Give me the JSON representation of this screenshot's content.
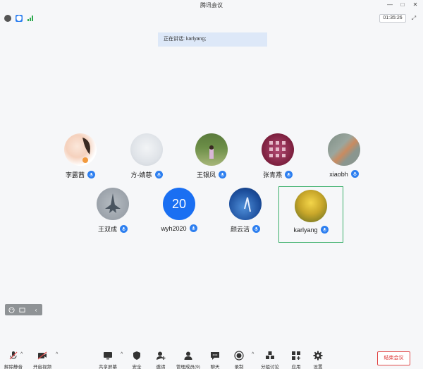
{
  "window": {
    "title": "腾讯会议",
    "minimize": "—",
    "maximize": "□",
    "close": "✕"
  },
  "status": {
    "timer": "01:35:26"
  },
  "speaking_banner": "正在讲话: karlyang;",
  "participants": [
    {
      "name": "李露茜"
    },
    {
      "name": "方-婧慈"
    },
    {
      "name": "王银凤"
    },
    {
      "name": "张青燕"
    },
    {
      "name": "xiaobh"
    },
    {
      "name": "王双成"
    },
    {
      "name": "wyh2020",
      "avatar_text": "20"
    },
    {
      "name": "颜云洁"
    },
    {
      "name": "karlyang"
    }
  ],
  "toolbar": {
    "unmute": "解除静音",
    "video": "开启视频",
    "share": "共享屏幕",
    "security": "安全",
    "invite": "邀请",
    "manage": "管理成员(9)",
    "chat": "聊天",
    "record": "录制",
    "breakout": "分组讨论",
    "apps": "应用",
    "settings": "设置",
    "end": "结束会议"
  },
  "colors": {
    "accent": "#2d7ff0",
    "active_border": "#3aaf6a",
    "end": "#d33333"
  }
}
